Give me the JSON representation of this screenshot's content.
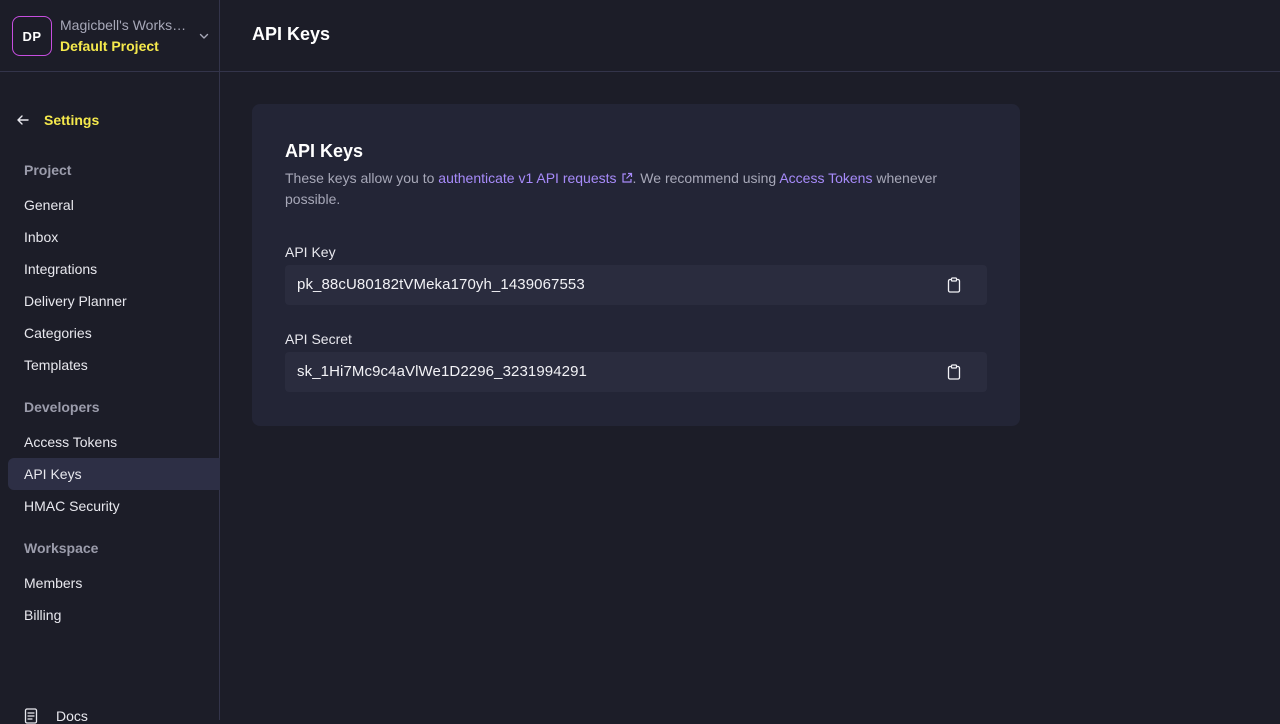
{
  "workspace": {
    "avatar_initials": "DP",
    "name": "Magicbell's Workspace",
    "project": "Default Project"
  },
  "nav": {
    "back_label": "Settings",
    "sections": [
      {
        "title": "Project",
        "items": [
          "General",
          "Inbox",
          "Integrations",
          "Delivery Planner",
          "Categories",
          "Templates"
        ]
      },
      {
        "title": "Developers",
        "items": [
          "Access Tokens",
          "API Keys",
          "HMAC Security"
        ]
      },
      {
        "title": "Workspace",
        "items": [
          "Members",
          "Billing"
        ]
      }
    ],
    "active_item": "API Keys",
    "docs_label": "Docs"
  },
  "header": {
    "title": "API Keys"
  },
  "card": {
    "title": "API Keys",
    "desc_prefix": "These keys allow you to ",
    "desc_link1": "authenticate v1 API requests",
    "desc_middle": ". We recommend using ",
    "desc_link2": "Access Tokens",
    "desc_suffix": " whenever possible.",
    "api_key_label": "API Key",
    "api_key_value": "pk_88cU80182tVMeka170yh_1439067553",
    "api_secret_label": "API Secret",
    "api_secret_value": "sk_1Hi7Mc9c4aVlWe1D2296_3231994291"
  },
  "colors": {
    "background": "#1c1d28",
    "accent_yellow": "#f5e94c",
    "link_purple": "#a78bfa",
    "avatar_border": "#c64ee0"
  },
  "icons": {
    "back": "arrow-left-icon",
    "switcher": "chevron-down-icon",
    "external": "external-link-icon",
    "copy": "clipboard-icon",
    "docs": "document-icon"
  }
}
